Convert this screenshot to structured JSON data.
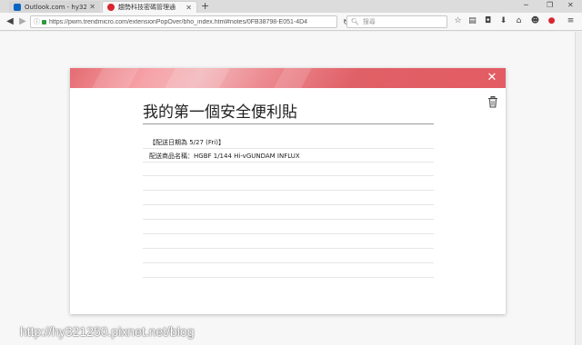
{
  "tabs": [
    {
      "title": "Outlook.com - hy32125…",
      "favicon_color": "#0a64c4",
      "active": false
    },
    {
      "title": "趨勢科技密碼管理通",
      "favicon_color": "#d8252f",
      "active": true
    }
  ],
  "toolbar": {
    "url": "https://pwm.trendmicro.com/extensionPopOver/bho_index.html#notes/0FB38798-E051-4D4",
    "search_placeholder": "搜尋"
  },
  "note": {
    "title": "我的第一個安全便利貼",
    "lines": [
      "【配送日期為 5/27 (Fri)】",
      "配送商品名稱：HGBF 1/144 Hi-vGUNDAM INFLUX",
      "",
      "",
      "",
      "",
      "",
      "",
      "",
      ""
    ]
  },
  "watermark": "http://hy321250.pixnet.net/blog",
  "colors": {
    "header_red": "#e35c63",
    "accent": "#d8252f"
  }
}
